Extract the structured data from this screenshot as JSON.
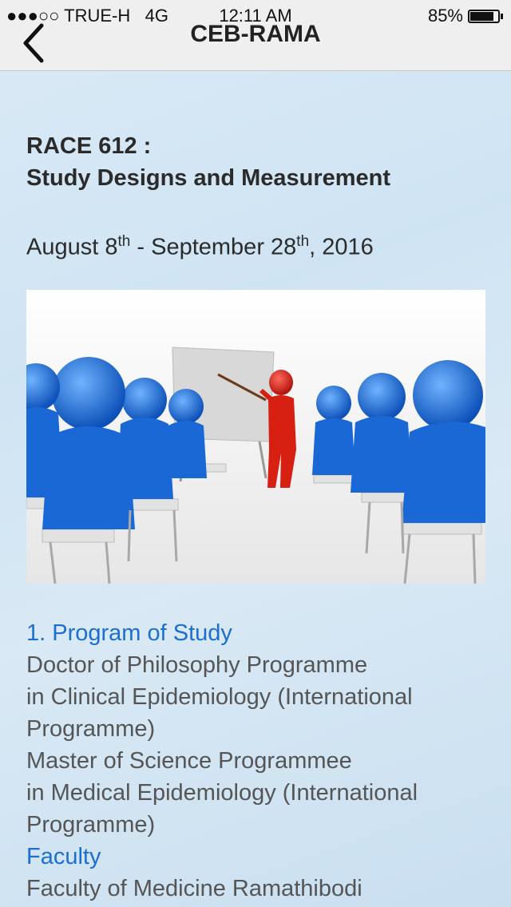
{
  "status_bar": {
    "carrier": "●●●○○ TRUE-H",
    "network": "4G",
    "time": "12:11 AM",
    "battery_percent": "85%",
    "battery_level": 0.85
  },
  "nav": {
    "title": "CEB-RAMA",
    "back_icon": "chevron-left-icon"
  },
  "course": {
    "code": "RACE 612 :",
    "title": "Study Designs and Measurement",
    "dates": {
      "start_month": "August 8",
      "start_suffix": "th",
      "separator": " - September 28",
      "end_suffix": "th",
      "year": ", 2016"
    }
  },
  "hero_icon": "classroom-presentation-illustration",
  "sections": {
    "program_heading": "1. Program of Study",
    "program_lines": [
      "Doctor of Philosophy Programme",
      "in Clinical Epidemiology (International",
      "Programme)",
      "Master of Science Programmee",
      "in Medical Epidemiology (International",
      "Programme)"
    ],
    "faculty_heading": "Faculty",
    "faculty_lines": [
      "Faculty of Medicine Ramathibodi"
    ]
  }
}
